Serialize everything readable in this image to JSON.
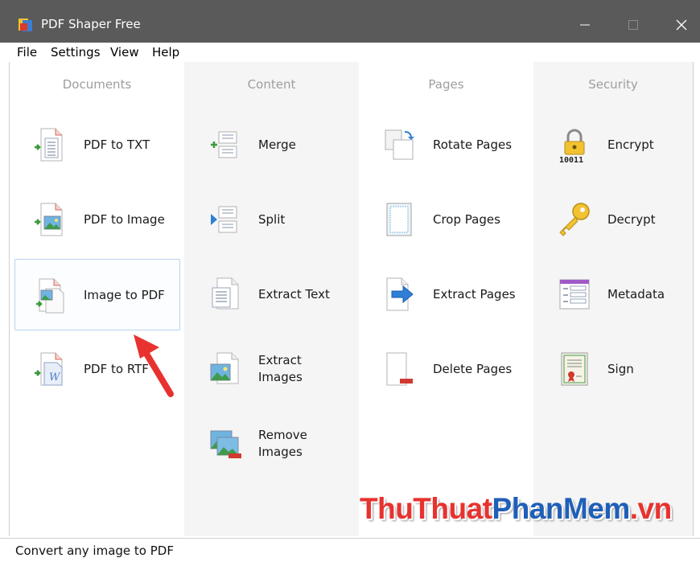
{
  "window": {
    "title": "PDF Shaper Free"
  },
  "menu": [
    "File",
    "Settings",
    "View",
    "Help"
  ],
  "columns": [
    {
      "title": "Documents",
      "tools": [
        "PDF to TXT",
        "PDF to Image",
        "Image to PDF",
        "PDF to RTF"
      ]
    },
    {
      "title": "Content",
      "tools": [
        "Merge",
        "Split",
        "Extract Text",
        "Extract\nImages",
        "Remove\nImages"
      ]
    },
    {
      "title": "Pages",
      "tools": [
        "Rotate Pages",
        "Crop Pages",
        "Extract Pages",
        "Delete Pages"
      ]
    },
    {
      "title": "Security",
      "tools": [
        "Encrypt",
        "Decrypt",
        "Metadata",
        "Sign"
      ]
    }
  ],
  "selected_tool": "Image to PDF",
  "status": {
    "text": "Convert any image to PDF"
  },
  "watermark": {
    "part1": "ThuThuat",
    "part2": "PhanMem",
    "part3": ".vn"
  },
  "icons": {
    "encrypt_digits": "10011"
  },
  "colors": {
    "titlebar": "#5a5a5a",
    "column_alt": "#f5f5f5",
    "accent_red": "#e8322f",
    "accent_blue": "#1f5fb8",
    "selection_border": "#b8d4ee"
  }
}
